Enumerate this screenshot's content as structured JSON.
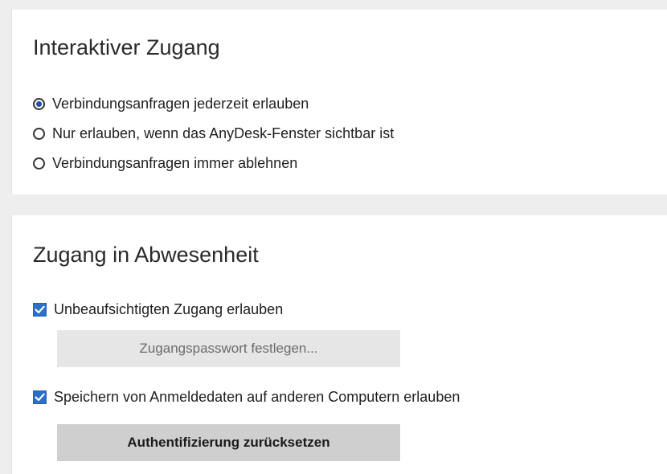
{
  "interactive_access": {
    "title": "Interaktiver Zugang",
    "options": [
      {
        "label": "Verbindungsanfragen jederzeit erlauben",
        "selected": true
      },
      {
        "label": "Nur erlauben, wenn das AnyDesk-Fenster sichtbar ist",
        "selected": false
      },
      {
        "label": "Verbindungsanfragen immer ablehnen",
        "selected": false
      }
    ]
  },
  "unattended_access": {
    "title": "Zugang in Abwesenheit",
    "allow_unattended": {
      "label": "Unbeaufsichtigten Zugang erlauben",
      "checked": true
    },
    "set_password_button": {
      "label": "Zugangspasswort festlegen...",
      "enabled": false
    },
    "store_credentials": {
      "label": "Speichern von Anmeldedaten auf anderen Computern erlauben",
      "checked": true
    },
    "reset_auth_button": {
      "label": "Authentifizierung zurücksetzen",
      "enabled": true
    }
  },
  "colors": {
    "accent": "#2b6fc8",
    "panel_bg": "#ffffff",
    "page_bg": "#eeeeee"
  }
}
